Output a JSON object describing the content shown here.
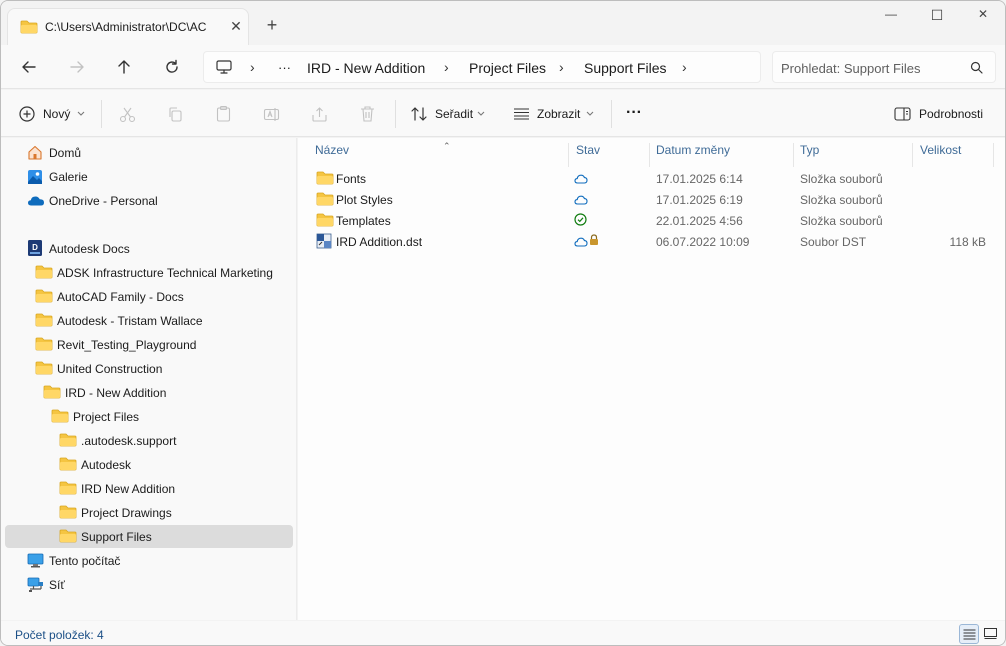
{
  "window": {
    "tab_title": "C:\\Users\\Administrator\\DC\\AC",
    "tab_close": "✕",
    "new_tab": "+",
    "minimize": "—",
    "maximize": "☐",
    "close": "✕"
  },
  "nav": {
    "more": "···",
    "breadcrumbs": [
      "IRD - New Addition",
      "Project Files",
      "Support Files"
    ],
    "separator": "›",
    "search_placeholder": "Prohledat: Support Files"
  },
  "commands": {
    "new_label": "Nový",
    "sort_label": "Seřadit",
    "view_label": "Zobrazit",
    "more": "···",
    "details_label": "Podrobnosti"
  },
  "sidebar": {
    "items": [
      {
        "label": "Domů",
        "icon": "home-icon"
      },
      {
        "label": "Galerie",
        "icon": "gallery-icon"
      },
      {
        "label": "OneDrive - Personal",
        "icon": "onedrive-icon"
      },
      {
        "label": "Autodesk Docs",
        "icon": "autodesk-docs-icon"
      },
      {
        "label": "ADSK Infrastructure Technical Marketing",
        "icon": "folder-icon"
      },
      {
        "label": "AutoCAD Family - Docs",
        "icon": "folder-icon"
      },
      {
        "label": "Autodesk - Tristam Wallace",
        "icon": "folder-icon"
      },
      {
        "label": "Revit_Testing_Playground",
        "icon": "folder-icon"
      },
      {
        "label": "United Construction",
        "icon": "folder-icon"
      },
      {
        "label": "IRD - New Addition",
        "icon": "folder-icon"
      },
      {
        "label": "Project Files",
        "icon": "folder-icon"
      },
      {
        "label": ".autodesk.support",
        "icon": "folder-icon"
      },
      {
        "label": "Autodesk",
        "icon": "folder-icon"
      },
      {
        "label": "IRD New Addition",
        "icon": "folder-icon"
      },
      {
        "label": "Project Drawings",
        "icon": "folder-icon"
      },
      {
        "label": "Support Files",
        "icon": "folder-icon",
        "selected": true
      },
      {
        "label": "Tento počítač",
        "icon": "this-pc-icon"
      },
      {
        "label": "Síť",
        "icon": "network-icon"
      }
    ]
  },
  "files": {
    "columns": [
      "Název",
      "Stav",
      "Datum změny",
      "Typ",
      "Velikost"
    ],
    "rows": [
      {
        "name": "Fonts",
        "status": "cloud",
        "date": "17.01.2025 6:14",
        "type": "Složka souborů",
        "size": ""
      },
      {
        "name": "Plot Styles",
        "status": "cloud",
        "date": "17.01.2025 6:19",
        "type": "Složka souborů",
        "size": ""
      },
      {
        "name": "Templates",
        "status": "synced",
        "date": "22.01.2025 4:56",
        "type": "Složka souborů",
        "size": ""
      },
      {
        "name": "IRD Addition.dst",
        "status": "cloud-locked",
        "date": "06.07.2022 10:09",
        "type": "Soubor DST",
        "size": "118 kB"
      }
    ]
  },
  "status": {
    "item_count": "Počet položek: 4"
  },
  "colors": {
    "folder": "#f5c542",
    "accent": "#0f6cbd",
    "selected_bg": "#dcdcdc",
    "header_text": "#3f6b97"
  }
}
